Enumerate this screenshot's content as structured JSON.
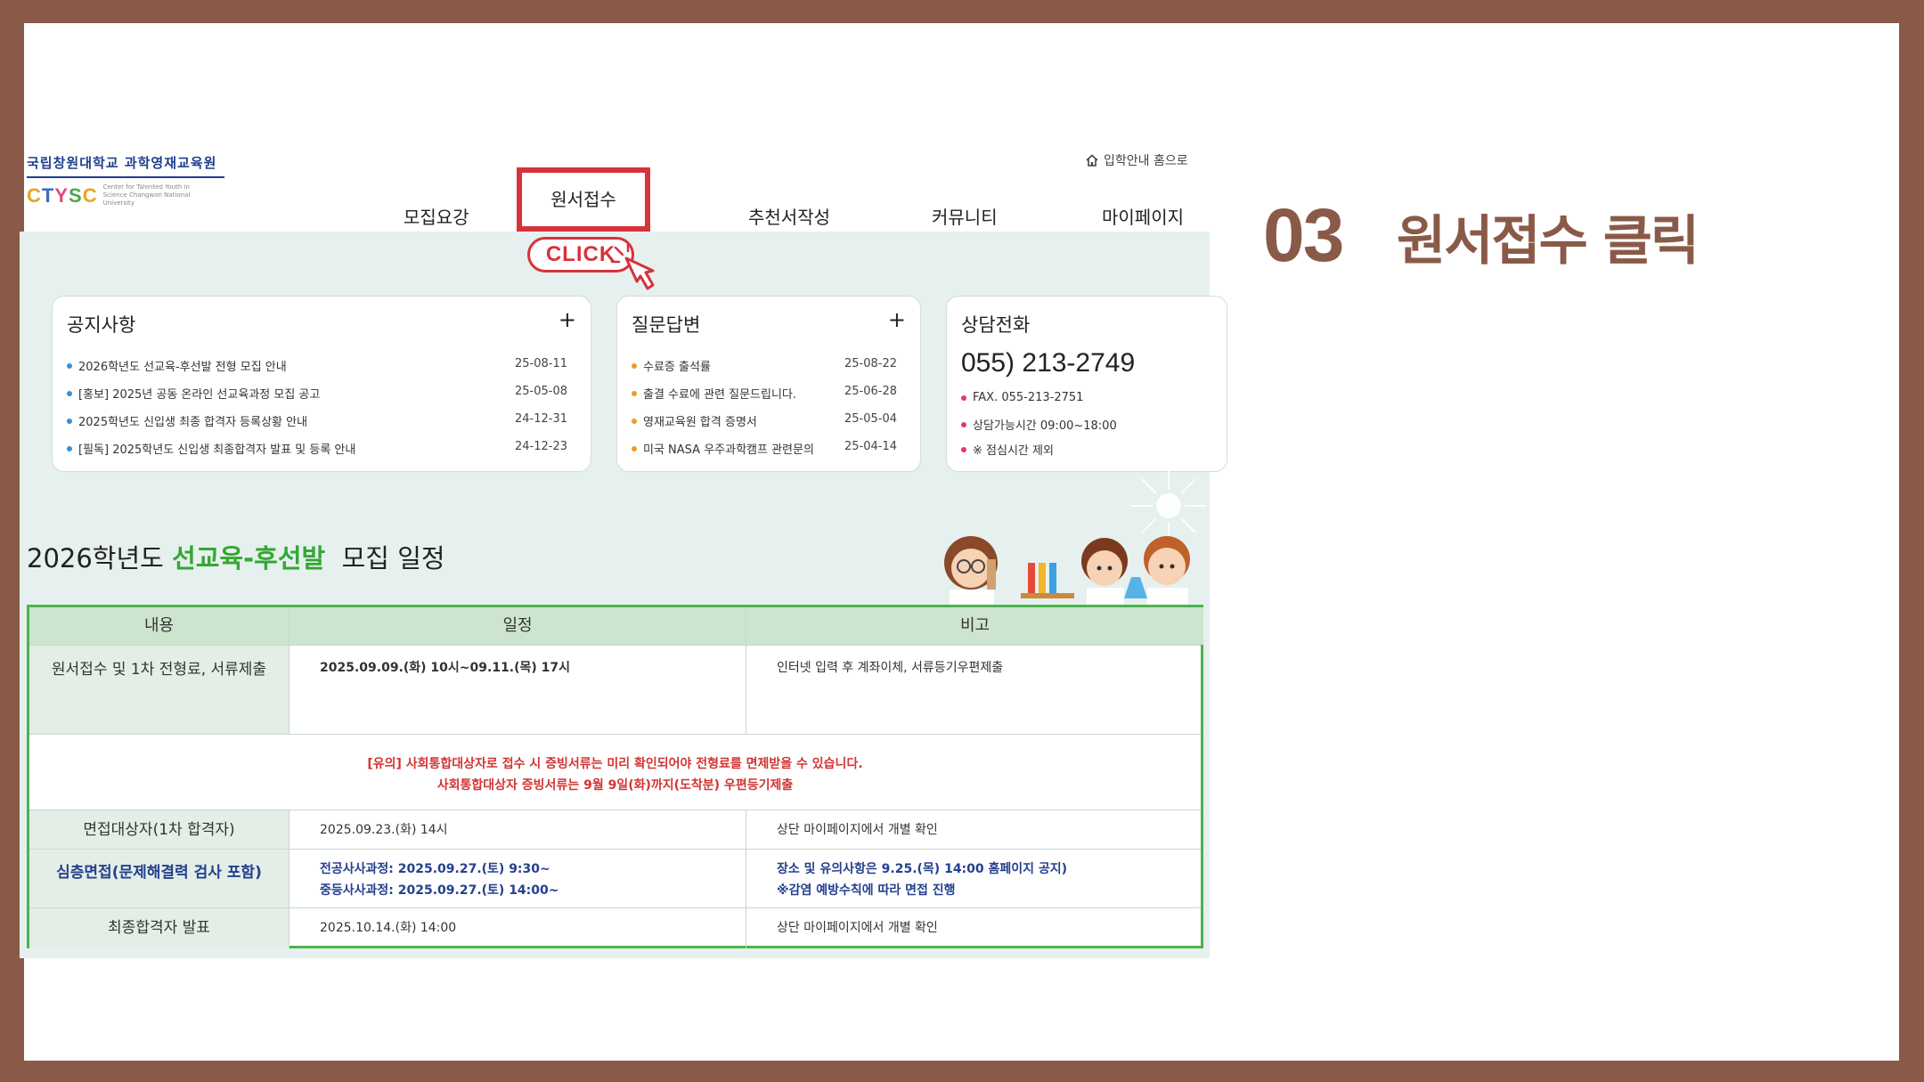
{
  "header": {
    "logo_kr": "국립창원대학교 과학영재교육원",
    "logo_en": "CTYSC",
    "logo_sub": "Center for Talented Youth in Science Changwon National University",
    "home_link": "입학안내 홈으로"
  },
  "nav": {
    "items": [
      "모집요강",
      "원서접수",
      "추천서작성",
      "커뮤니티",
      "마이페이지"
    ],
    "click_label": "CLICK"
  },
  "notice": {
    "title": "공지사항",
    "plus": "+",
    "items": [
      {
        "text": "2026학년도 선교육-후선발 전형 모집 안내",
        "date": "25-08-11"
      },
      {
        "text": "[홍보] 2025년 공동 온라인 선교육과정 모집 공고",
        "date": "25-05-08"
      },
      {
        "text": "2025학년도 신입생 최종 합격자 등록상황 안내",
        "date": "24-12-31"
      },
      {
        "text": "[필독] 2025학년도 신입생 최종합격자 발표 및 등록 안내",
        "date": "24-12-23"
      }
    ]
  },
  "qna": {
    "title": "질문답변",
    "plus": "+",
    "items": [
      {
        "text": "수료증 출석률",
        "date": "25-08-22"
      },
      {
        "text": "출결 수료에 관련 질문드립니다.",
        "date": "25-06-28"
      },
      {
        "text": "영재교육원 합격 증명서",
        "date": "25-05-04"
      },
      {
        "text": "미국 NASA 우주과학캠프 관련문의",
        "date": "25-04-14"
      }
    ]
  },
  "contact": {
    "title": "상담전화",
    "phone": "055) 213-2749",
    "items": [
      "FAX. 055-213-2751",
      "상담가능시간 09:00~18:00",
      "※ 점심시간 제외"
    ]
  },
  "schedule": {
    "title_prefix": "2026학년도",
    "title_green": "선교육-후선발",
    "title_suffix": "모집 일정",
    "headers": [
      "내용",
      "일정",
      "비고"
    ],
    "rows": [
      {
        "a": "원서접수 및 1차 전형료, 서류제출",
        "b": "2025.09.09.(화) 10시~09.11.(목) 17시",
        "c": "인터넷 입력 후 계좌이체, 서류등기우편제출"
      },
      {
        "note1": "[유의] 사회통합대상자로 접수 시 증빙서류는 미리 확인되어야 전형료를 면제받을 수 있습니다.",
        "note2": "사회통합대상자 증빙서류는 9월 9일(화)까지(도착분) 우편등기제출"
      },
      {
        "a": "면접대상자(1차 합격자)",
        "b": "2025.09.23.(화) 14시",
        "c": "상단 마이페이지에서 개별 확인"
      },
      {
        "a": "심층면접(문제해결력 검사 포함)",
        "b1": "전공사사과정: 2025.09.27.(토) 9:30~",
        "b2": "중등사사과정: 2025.09.27.(토) 14:00~",
        "c1": "장소 및 유의사항은 9.25.(목) 14:00 홈페이지 공지)",
        "c2": "※감염 예방수칙에 따라 면접 진행"
      },
      {
        "a": "최종합격자 발표",
        "b": "2025.10.14.(화) 14:00",
        "c": "상단 마이페이지에서 개별 확인"
      }
    ]
  },
  "step": {
    "number": "03",
    "text": "원서접수 클릭"
  },
  "colors": {
    "frame": "#8a5a48",
    "highlight": "#d8323a",
    "panel": "#e6f0ef",
    "green": "#33a832",
    "navy": "#25408f"
  }
}
